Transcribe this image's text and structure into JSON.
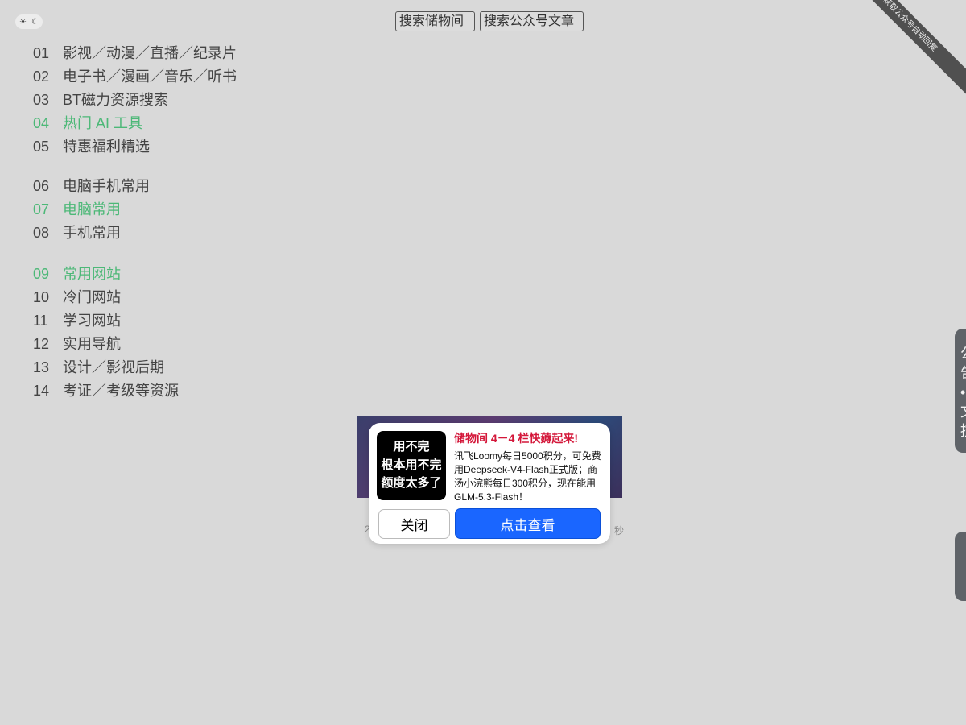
{
  "header": {
    "theme_toggle": {
      "sun_icon": "☀",
      "moon_icon": "☾"
    },
    "search_storage_placeholder": "搜索储物间",
    "search_article_placeholder": "搜索公众号文章",
    "corner_ribbon": "获取公众号自动回复"
  },
  "nav": {
    "items": [
      {
        "num": "01",
        "label": "影视／动漫／直播／纪录片"
      },
      {
        "num": "02",
        "label": "电子书／漫画／音乐／听书"
      },
      {
        "num": "03",
        "label": "BT磁力资源搜索"
      },
      {
        "num": "04",
        "label": "热门 AI 工具"
      },
      {
        "num": "05",
        "label": "特惠福利精选"
      },
      {
        "num": "06",
        "label": "电脑手机常用"
      },
      {
        "num": "07",
        "label": "电脑常用"
      },
      {
        "num": "08",
        "label": "手机常用"
      },
      {
        "num": "09",
        "label": "常用网站"
      },
      {
        "num": "10",
        "label": "冷门网站"
      },
      {
        "num": "11",
        "label": "学习网站"
      },
      {
        "num": "12",
        "label": "实用导航"
      },
      {
        "num": "13",
        "label": "设计／影视后期"
      },
      {
        "num": "14",
        "label": "考证／考级等资源"
      }
    ],
    "active_color": "#4cb877"
  },
  "footer": {
    "left": "2",
    "right": "秒"
  },
  "popup": {
    "logo_lines": [
      "用不完",
      "根本用不完",
      "额度太多了"
    ],
    "title": "储物间 4－4 栏快薅起来!",
    "body": "讯飞Loomy每日5000积分，可免费用Deepseek-V4-Flash正式版；商汤小浣熊每日300积分，现在能用GLM-5.3-Flash！",
    "close_label": "关闭",
    "view_label": "点击查看",
    "title_color": "#d4173a",
    "button_color": "#1a66ff"
  },
  "side": {
    "notice_chars": [
      "公",
      "告",
      "•",
      "文",
      "控"
    ]
  }
}
